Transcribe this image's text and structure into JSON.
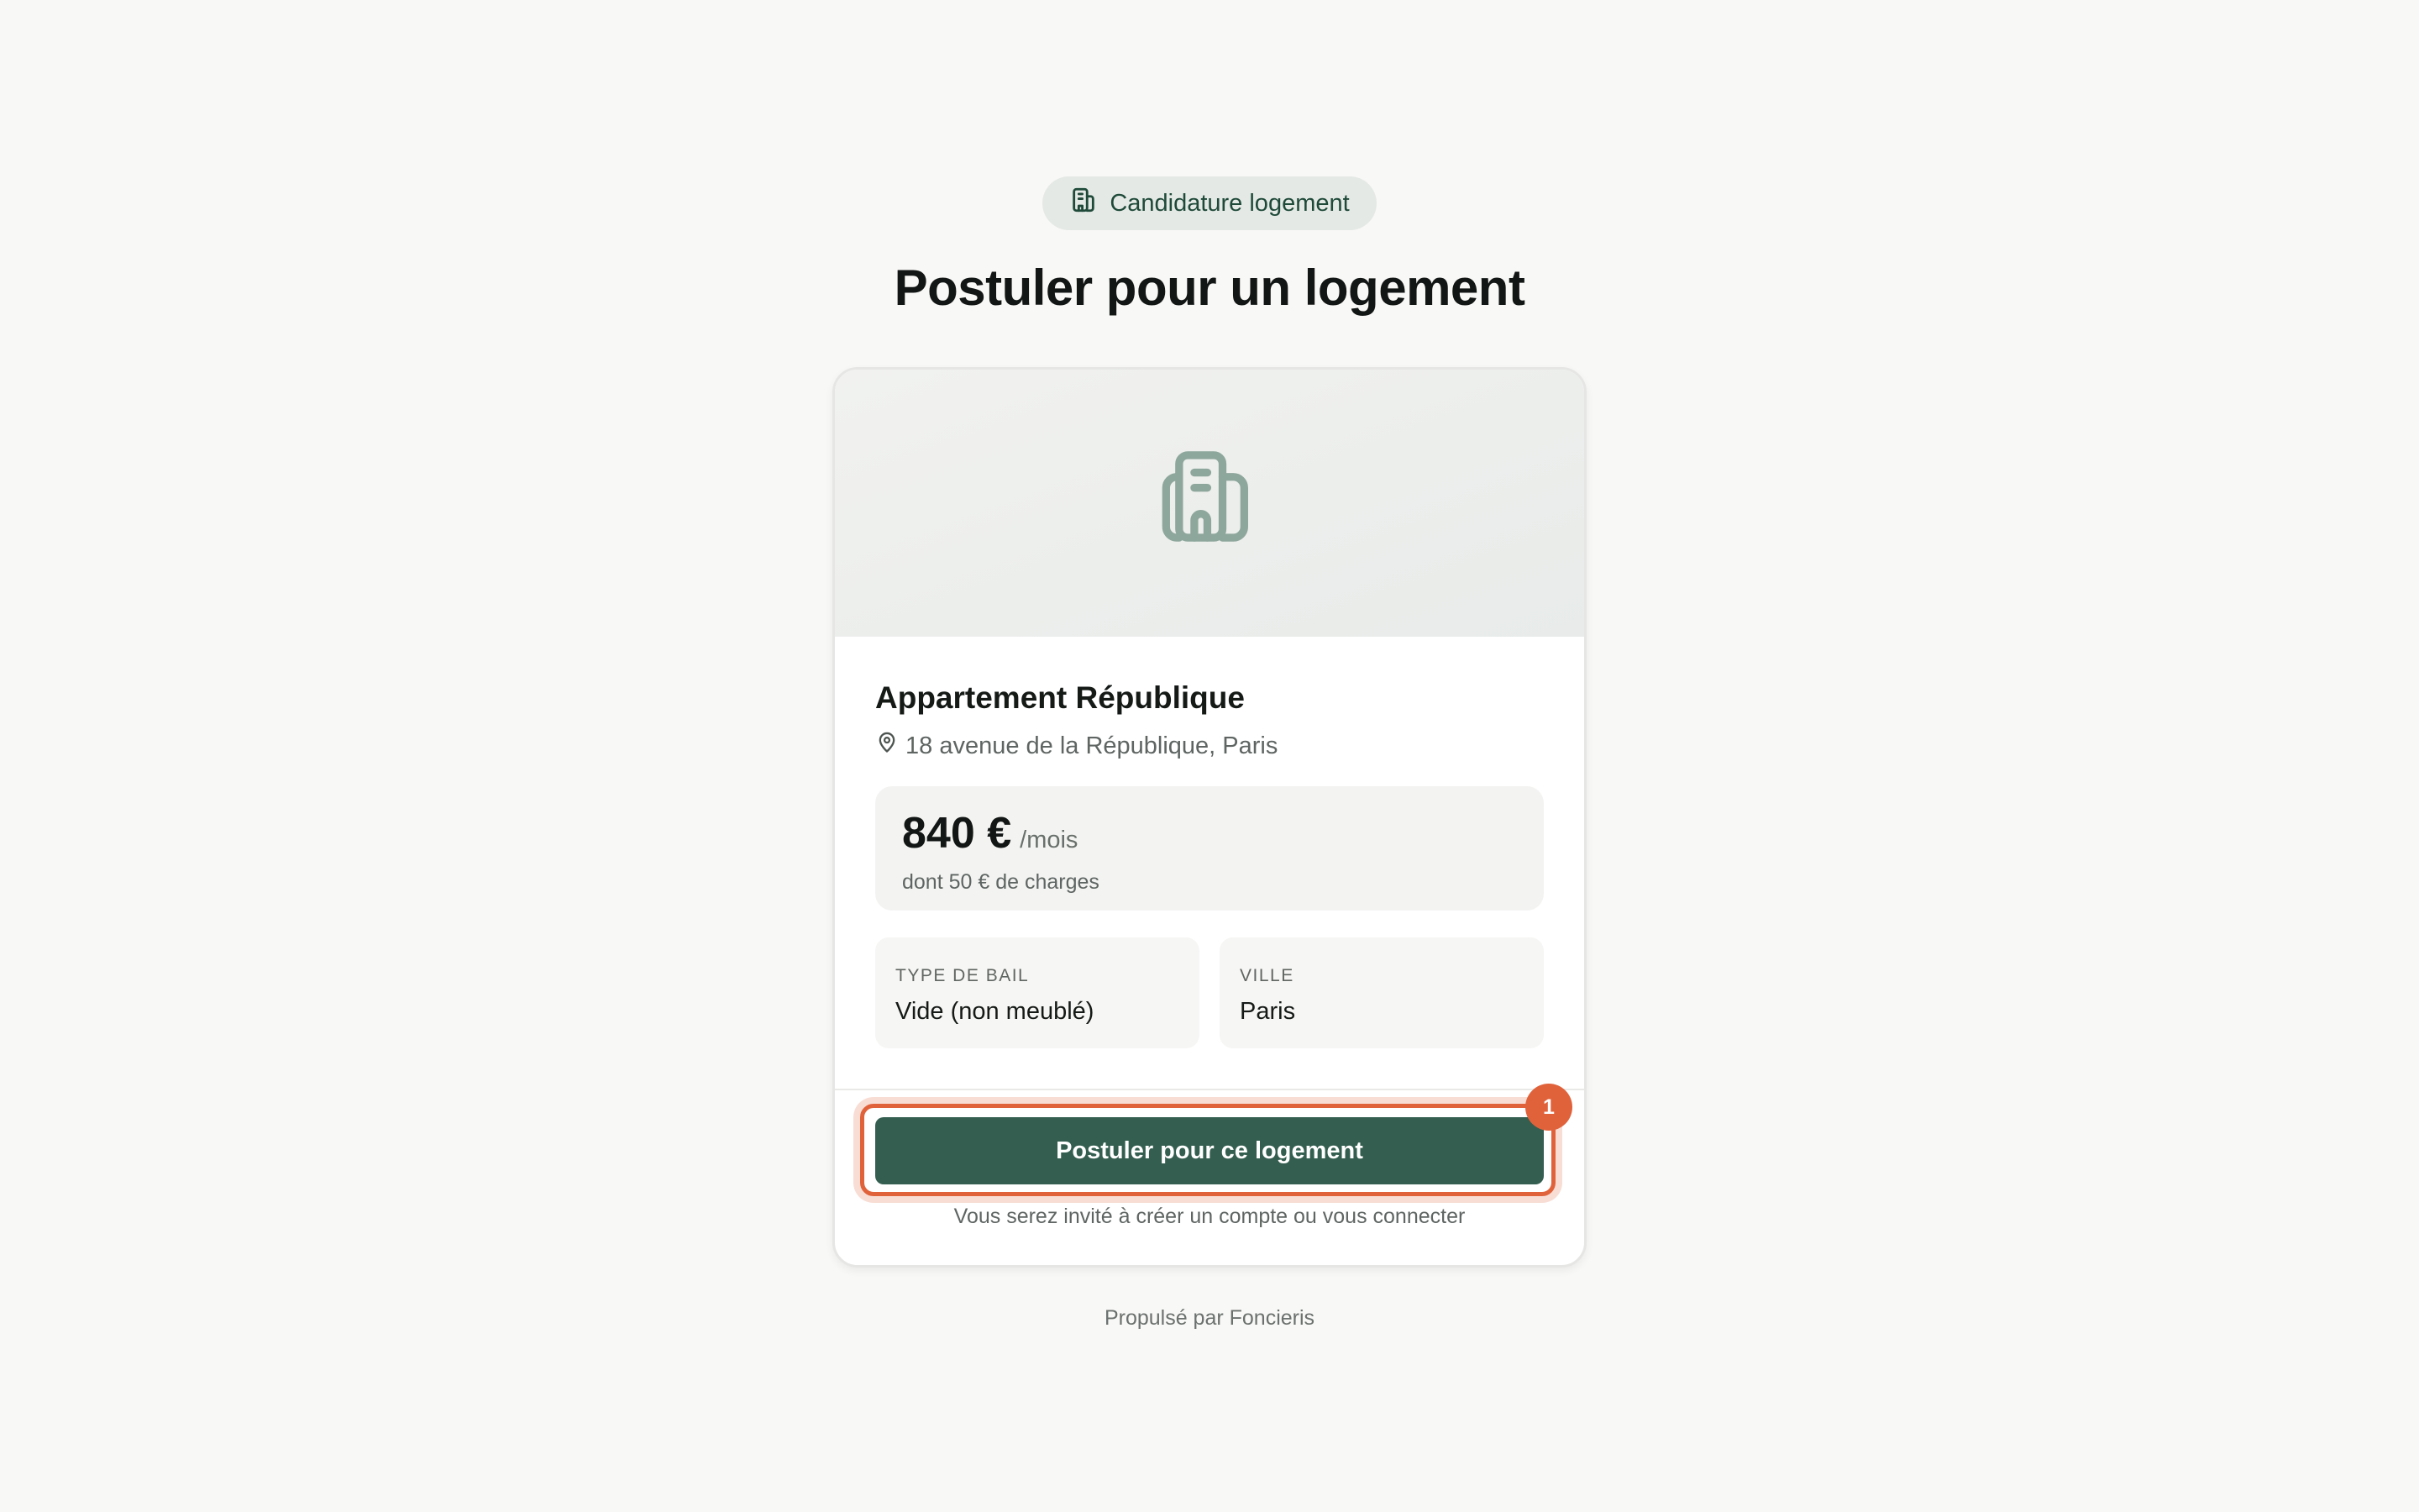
{
  "header": {
    "badge_label": "Candidature logement",
    "title": "Postuler pour un logement"
  },
  "property": {
    "name": "Appartement République",
    "address": "18 avenue de la République, Paris",
    "price": "840 €",
    "price_period": "/mois",
    "charges_note": "dont 50 € de charges",
    "facts": [
      {
        "label": "TYPE DE BAIL",
        "value": "Vide (non meublé)"
      },
      {
        "label": "VILLE",
        "value": "Paris"
      }
    ]
  },
  "cta": {
    "label": "Postuler pour ce logement",
    "marker_number": "1",
    "hint": "Vous serez invité à créer un compte ou vous connecter"
  },
  "footer": {
    "text": "Propulsé par Foncieris"
  },
  "colors": {
    "accent": "#335e50",
    "highlight": "#e0623b",
    "background": "#f8f8f6"
  },
  "icons": {
    "badge": "building-icon",
    "hero": "building-icon",
    "address": "map-pin-icon"
  }
}
